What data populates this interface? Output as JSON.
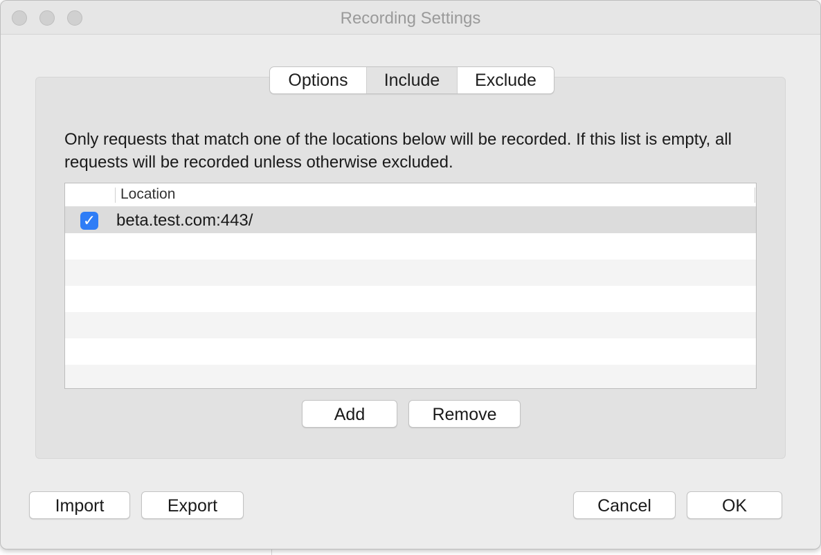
{
  "window": {
    "title": "Recording Settings"
  },
  "tabs": [
    {
      "label": "Options"
    },
    {
      "label": "Include",
      "selected": true
    },
    {
      "label": "Exclude"
    }
  ],
  "include": {
    "description": "Only requests that match one of the locations below will be recorded. If this list is empty, all requests will be recorded unless otherwise excluded.",
    "table": {
      "columns": [
        "",
        "Location"
      ],
      "rows": [
        {
          "enabled": true,
          "location": "beta.test.com:443/"
        }
      ]
    },
    "add_label": "Add",
    "remove_label": "Remove"
  },
  "footer": {
    "import_label": "Import",
    "export_label": "Export",
    "cancel_label": "Cancel",
    "ok_label": "OK"
  },
  "icons": {
    "checkbox": "checkmark-icon"
  },
  "colors": {
    "accent": "#2f7df6"
  }
}
